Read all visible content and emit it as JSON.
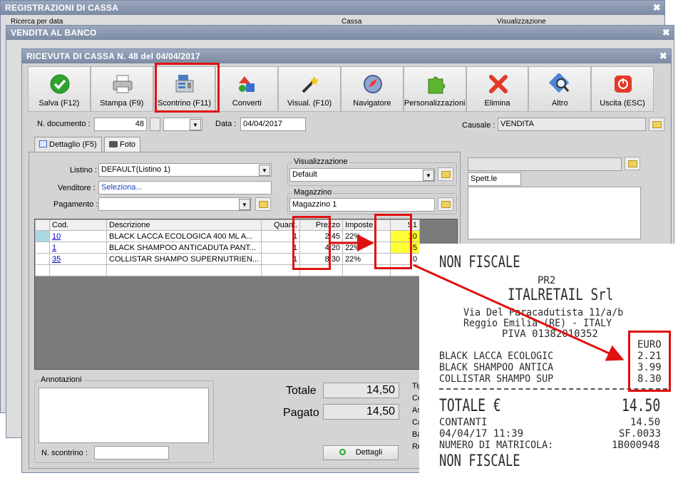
{
  "bg_windows": {
    "registrazioni_title": "REGISTRAZIONI DI CASSA",
    "ricerca": "Ricerca per data",
    "cassa": "Cassa",
    "visualizzazione": "Visualizzazione",
    "vendita_title": "VENDITA AL BANCO"
  },
  "main_title": "RICEVUTA DI CASSA N. 48 del 04/04/2017",
  "toolbar": [
    {
      "label": "Salva (F12)",
      "icon": "check-icon"
    },
    {
      "label": "Stampa (F9)",
      "icon": "printer-icon"
    },
    {
      "label": "Scontrino (F11)",
      "icon": "cash-register-icon"
    },
    {
      "label": "Converti",
      "icon": "convert-icon"
    },
    {
      "label": "Visual. (F10)",
      "icon": "magic-wand-icon"
    },
    {
      "label": "Navigatore",
      "icon": "compass-icon"
    },
    {
      "label": "Personalizzazioni",
      "icon": "puzzle-icon"
    },
    {
      "label": "Elimina",
      "icon": "delete-icon"
    },
    {
      "label": "Altro",
      "icon": "search-icon"
    },
    {
      "label": "Uscita (ESC)",
      "icon": "power-icon"
    }
  ],
  "doc": {
    "n_label": "N. documento :",
    "n_value": "48",
    "data_label": "Data :",
    "data_value": "04/04/2017",
    "causale_label": "Causale :",
    "causale_value": "VENDITA"
  },
  "tabs": {
    "dettaglio": "Dettaglio (F5)",
    "foto": "Foto"
  },
  "form": {
    "listino_label": "Listino :",
    "listino_value": "DEFAULT(Listino 1)",
    "venditore_label": "Venditore :",
    "venditore_value": "Seleziona...",
    "pagamento_label": "Pagamento :",
    "pagamento_value": "",
    "visualizzazione_label": "Visualizzazione",
    "visualizzazione_value": "Default",
    "magazzino_label": "Magazzino",
    "magazzino_value": "Magazzino 1",
    "spett": "Spett.le"
  },
  "table": {
    "headers": [
      "Cod.",
      "Descrizione",
      "Quant.",
      "Prezzo",
      "Imposte",
      "S1"
    ],
    "rows": [
      {
        "cod": "10",
        "desc": "BLACK LACCA ECOLOGICA 400 ML A...",
        "qty": "1",
        "price": "2,45",
        "tax": "22%",
        "s1": "10"
      },
      {
        "cod": "1",
        "desc": "BLACK SHAMPOO ANTICADUTA PANT...",
        "qty": "1",
        "price": "4,20",
        "tax": "22%",
        "s1": "5"
      },
      {
        "cod": "35",
        "desc": "COLLISTAR SHAMPO SUPERNUTRIEN...",
        "qty": "1",
        "price": "8,30",
        "tax": "22%",
        "s1": "0"
      }
    ]
  },
  "annotazioni": {
    "label": "Annotazioni",
    "scontrino_label": "N. scontrino :"
  },
  "totals": {
    "totale_label": "Totale",
    "totale_value": "14,50",
    "pagato_label": "Pagato",
    "pagato_value": "14,50",
    "dettagli": "Dettagli"
  },
  "side_labels": [
    "Tip",
    "Co",
    "As",
    "Ca",
    "Ba",
    "Re"
  ],
  "receipt": {
    "non_fiscale": "NON FISCALE",
    "pr2": "PR2",
    "company": "ITALRETAIL Srl",
    "address": "Via Del Paracadutista 11/a/b",
    "city": "Reggio Emilia (RE) -  ITALY",
    "piva": "PIVA 01382010352",
    "euro": "EURO",
    "items": [
      {
        "name": "BLACK LACCA ECOLOGIC",
        "price": "2.21"
      },
      {
        "name": "BLACK SHAMPOO ANTICA",
        "price": "3.99"
      },
      {
        "name": "COLLISTAR SHAMPO SUP",
        "price": "8.30"
      }
    ],
    "totale_label": "TOTALE €",
    "totale_value": "14.50",
    "contanti_label": "CONTANTI",
    "contanti_value": "14.50",
    "datetime": "04/04/17 11:39",
    "sf": "SF.0033",
    "matricola_label": "NUMERO DI MATRICOLA:",
    "matricola_value": "1B000948",
    "non_fiscale_bottom": "NON FISCALE"
  }
}
